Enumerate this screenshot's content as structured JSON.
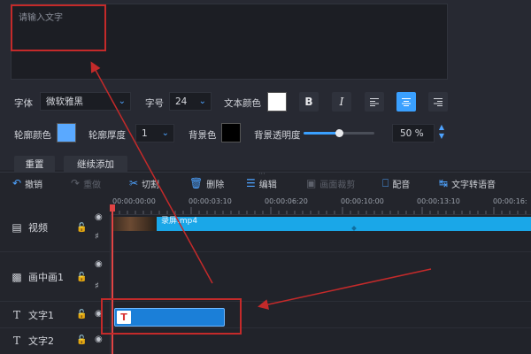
{
  "editor": {
    "placeholder": "请输入文字",
    "font_label": "字体",
    "font_value": "微软雅黑",
    "size_label": "字号",
    "size_value": "24",
    "text_color_label": "文本颜色",
    "text_color": "#ffffff",
    "bold": "B",
    "italic": "I",
    "outline_color_label": "轮廓颜色",
    "outline_color": "#5aa9ff",
    "outline_width_label": "轮廓厚度",
    "outline_width_value": "1",
    "bg_color_label": "背景色",
    "bg_color": "#000000",
    "bg_opacity_label": "背景透明度",
    "bg_opacity_value": "50 %",
    "bg_opacity_fraction": 0.5,
    "reset_label": "重置",
    "continue_add_label": "继续添加"
  },
  "toolbar": {
    "undo": "撤销",
    "redo": "重做",
    "cut": "切割",
    "delete": "删除",
    "edit": "编辑",
    "crop": "画面裁剪",
    "dub": "配音",
    "tts": "文字转语音"
  },
  "timeline": {
    "ticks": [
      "00:00:00:00",
      "00:00:03:10",
      "00:00:06:20",
      "00:00:10:00",
      "00:00:13:10",
      "00:00:16:"
    ],
    "tracks": [
      "视频",
      "画中画1",
      "文字1",
      "文字2"
    ],
    "video_clip_name": "录屏.mp4",
    "text_clip_badge": "T"
  },
  "colors": {
    "accent": "#3aa0ff",
    "annotation": "#c42a2a"
  }
}
